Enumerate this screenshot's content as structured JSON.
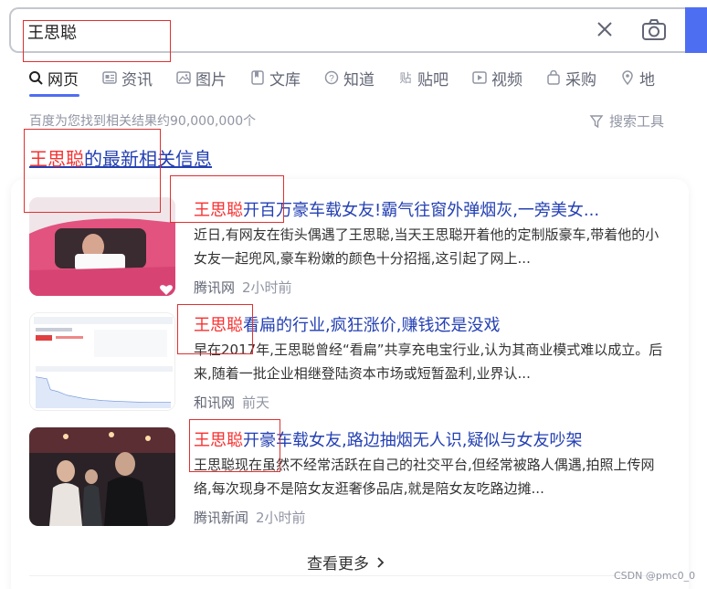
{
  "search": {
    "query": "王思聪"
  },
  "tabs": [
    {
      "label": "网页",
      "icon": "search-icon"
    },
    {
      "label": "资讯",
      "icon": "news-icon"
    },
    {
      "label": "图片",
      "icon": "image-icon"
    },
    {
      "label": "文库",
      "icon": "document-icon"
    },
    {
      "label": "知道",
      "icon": "question-icon"
    },
    {
      "label": "贴吧",
      "icon": "tieba-icon"
    },
    {
      "label": "视频",
      "icon": "video-icon"
    },
    {
      "label": "采购",
      "icon": "shopping-bag-icon"
    },
    {
      "label": "地",
      "icon": "map-icon"
    }
  ],
  "result_count": "百度为您找到相关结果约90,000,000个",
  "search_tools": "搜索工具",
  "news_header": {
    "highlight": "王思聪",
    "rest": "的最新相关信息"
  },
  "items": [
    {
      "title_hl": "王思聪",
      "title_rest": "开百万豪车载女友!霸气往窗外弹烟灰,一旁美女...",
      "body": "近日,有网友在街头偶遇了王思聪,当天王思聪开着他的定制版豪车,带着他的小女友一起兜风,豪车粉嫩的颜色十分招摇,这引起了网上...",
      "source": "腾讯网",
      "time": "2小时前"
    },
    {
      "title_hl": "王思聪",
      "title_rest": "看扁的行业,疯狂涨价,赚钱还是没戏",
      "body": "早在2017年,王思聪曾经“看扁”共享充电宝行业,认为其商业模式难以成立。后来,随着一批企业相继登陆资本市场或短暂盈利,业界认...",
      "source": "和讯网",
      "time": "前天"
    },
    {
      "title_hl": "王思聪",
      "title_rest": "开豪车载女友,路边抽烟无人识,疑似与女友吵架",
      "body": "王思聪现在虽然不经常活跃在自己的社交平台,但经常被路人偶遇,拍照上传网络,每次现身不是陪女友逛奢侈品店,就是陪女友吃路边摊...",
      "source": "腾讯新闻",
      "time": "2小时前"
    }
  ],
  "more_label": "查看更多",
  "watermark": "CSDN @pmc0_0",
  "colors": {
    "accent": "#4e6ef2",
    "highlight": "#f73131",
    "link": "#2440b3",
    "annotation": "#e03030"
  }
}
